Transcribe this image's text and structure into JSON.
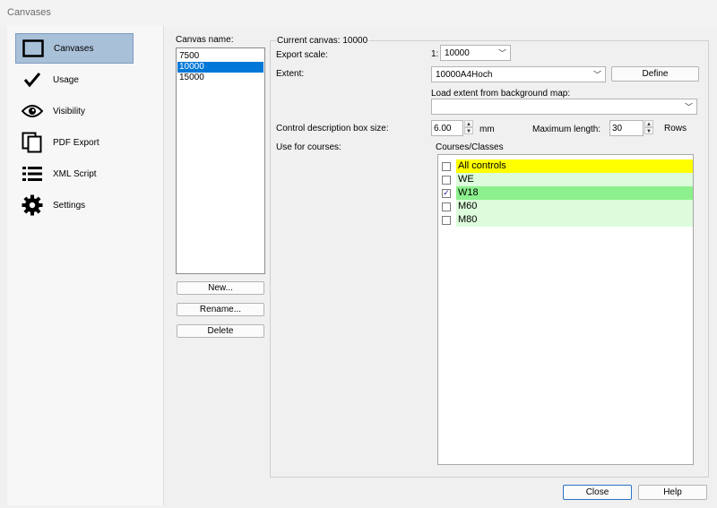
{
  "window": {
    "title": "Canvases"
  },
  "nav": {
    "items": [
      {
        "label": "Canvases",
        "icon": "canvas-icon",
        "selected": true
      },
      {
        "label": "Usage",
        "icon": "checkmark-icon",
        "selected": false
      },
      {
        "label": "Visibility",
        "icon": "eye-icon",
        "selected": false
      },
      {
        "label": "PDF Export",
        "icon": "pdf-pages-icon",
        "selected": false
      },
      {
        "label": "XML Script",
        "icon": "list-icon",
        "selected": false
      },
      {
        "label": "Settings",
        "icon": "gear-icon",
        "selected": false
      }
    ]
  },
  "canvas_list": {
    "label": "Canvas name:",
    "items": [
      "7500",
      "10000",
      "15000"
    ],
    "selected": "10000",
    "buttons": {
      "new": "New...",
      "rename": "Rename...",
      "delete": "Delete"
    }
  },
  "current": {
    "group_title": "Current canvas: 10000",
    "export_scale_label": "Export scale:",
    "scale_prefix": "1:",
    "scale_value": "10000",
    "extent_label": "Extent:",
    "extent_value": "10000A4Hoch",
    "define_button": "Define",
    "load_extent_label": "Load extent from background map:",
    "load_extent_value": "",
    "box_size_label": "Control description box size:",
    "box_size_value": "6.00",
    "box_size_unit": "mm",
    "max_length_label": "Maximum length:",
    "max_length_value": "30",
    "max_length_unit": "Rows",
    "use_for_courses_label": "Use for courses:",
    "courses_group_title": "Courses/Classes",
    "courses": [
      {
        "name": "All controls",
        "checked": false,
        "bg": "#ffff00"
      },
      {
        "name": "WE",
        "checked": false,
        "bg": "#dcfcdc"
      },
      {
        "name": "W18",
        "checked": true,
        "bg": "#8cf08c"
      },
      {
        "name": "M60",
        "checked": false,
        "bg": "#dcfcdc"
      },
      {
        "name": "M80",
        "checked": false,
        "bg": "#dcfcdc"
      }
    ]
  },
  "footer": {
    "close": "Close",
    "help": "Help"
  }
}
